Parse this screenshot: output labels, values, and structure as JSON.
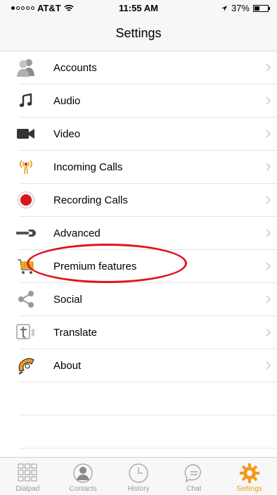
{
  "status_bar": {
    "carrier": "AT&T",
    "time": "11:55 AM",
    "battery_percent": "37%",
    "battery_level": 0.37
  },
  "header": {
    "title": "Settings"
  },
  "settings": [
    {
      "label": "Accounts",
      "icon": "accounts-icon"
    },
    {
      "label": "Audio",
      "icon": "music-note-icon"
    },
    {
      "label": "Video",
      "icon": "video-camera-icon"
    },
    {
      "label": "Incoming Calls",
      "icon": "antenna-icon"
    },
    {
      "label": "Recording Calls",
      "icon": "record-icon"
    },
    {
      "label": "Advanced",
      "icon": "wrench-icon"
    },
    {
      "label": "Premium features",
      "icon": "shopping-cart-icon"
    },
    {
      "label": "Social",
      "icon": "share-icon"
    },
    {
      "label": "Translate",
      "icon": "translate-icon"
    },
    {
      "label": "About",
      "icon": "about-icon"
    }
  ],
  "tabs": [
    {
      "label": "Dialpad",
      "icon": "dialpad-icon",
      "active": false
    },
    {
      "label": "Contacts",
      "icon": "contacts-icon",
      "active": false
    },
    {
      "label": "History",
      "icon": "clock-icon",
      "active": false
    },
    {
      "label": "Chat",
      "icon": "chat-icon",
      "active": false
    },
    {
      "label": "Settings",
      "icon": "gear-icon",
      "active": true
    }
  ],
  "colors": {
    "accent": "#f39a1d",
    "highlight_annotation": "#e0141e",
    "record_red": "#d9161b"
  }
}
